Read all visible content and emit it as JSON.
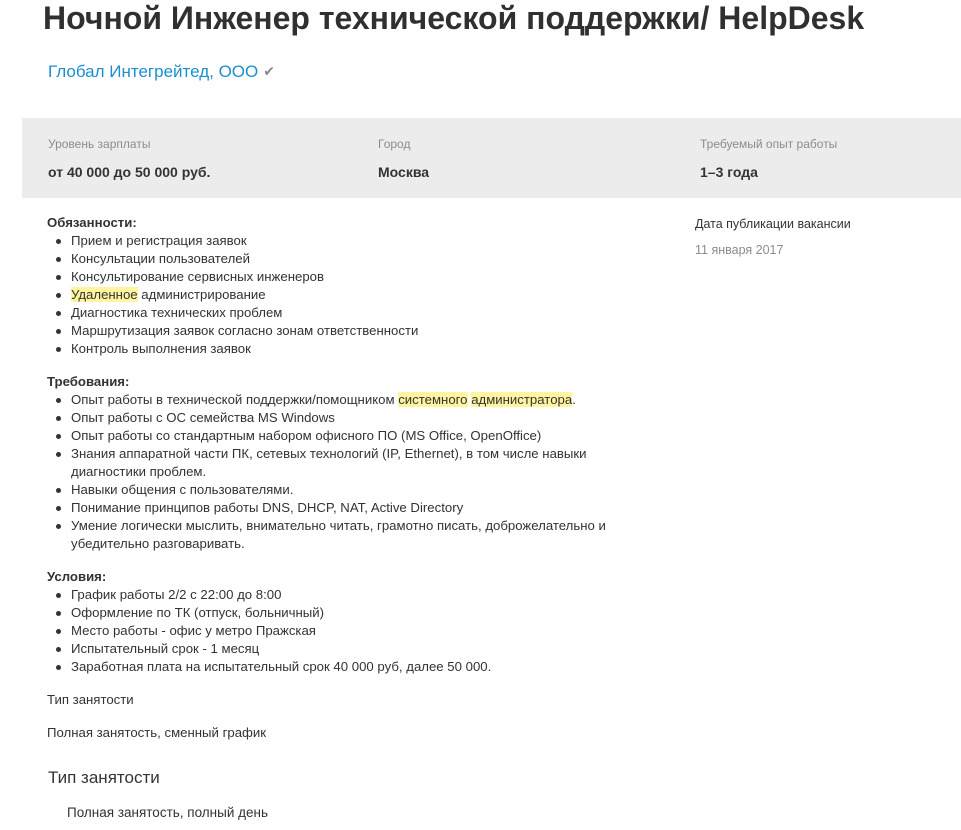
{
  "vacancy": {
    "title": "Ночной Инженер технической поддержки/ HelpDesk",
    "company": "Глобал Интегрейтед, ООО",
    "verified_icon": "checkmark-icon"
  },
  "info": {
    "salary_label": "Уровень зарплаты",
    "salary_value": "от 40 000 до 50 000 руб.",
    "city_label": "Город",
    "city_value": "Москва",
    "experience_label": "Требуемый опыт работы",
    "experience_value": "1–3 года"
  },
  "publication": {
    "label": "Дата публикации вакансии",
    "date": "11 января 2017"
  },
  "description": {
    "duties_title": "Обязанности:",
    "duties": [
      "Прием и регистрация заявок",
      "Консультации пользователей",
      "Консультирование сервисных инженеров",
      "Удаленное администрирование",
      "Диагностика технических проблем",
      "Маршрутизация заявок согласно зонам ответственности",
      "Контроль выполнения заявок"
    ],
    "requirements_title": "Требования:",
    "requirements": [
      "Опыт работы в технической поддержки/помощником системного администратора.",
      "Опыт работы с ОС семейства MS Windows",
      "Опыт работы со стандартным набором офисного ПО (MS Office, OpenOffice)",
      "Знания аппаратной части ПК, сетевых технологий (IP, Ethernet), в том числе навыки диагностики проблем.",
      "Навыки общения с пользователями.",
      "Понимание принципов работы DNS, DHCP, NAT, Active Directory",
      "Умение логически мыслить, внимательно читать, грамотно писать, доброжелательно и убедительно разговаривать."
    ],
    "conditions_title": "Условия:",
    "conditions": [
      "График работы 2/2 с 22:00 до 8:00",
      "Оформление по ТК (отпуск, больничный)",
      "Место работы - офис у метро Пражская",
      "Испытательный срок - 1 месяц",
      "Заработная плата на испытательный срок 40 000 руб, далее 50 000."
    ],
    "employment_label": "Тип занятости",
    "employment_value": "Полная занятость, сменный график"
  },
  "employment": {
    "heading": "Тип занятости",
    "value": "Полная занятость, полный день"
  },
  "highlights": [
    "Удаленное",
    "системного",
    "администратора"
  ],
  "colors": {
    "link": "#1b8fcf",
    "highlight": "#fff5a0",
    "panel": "#ececec",
    "muted": "#8c8c8c"
  }
}
